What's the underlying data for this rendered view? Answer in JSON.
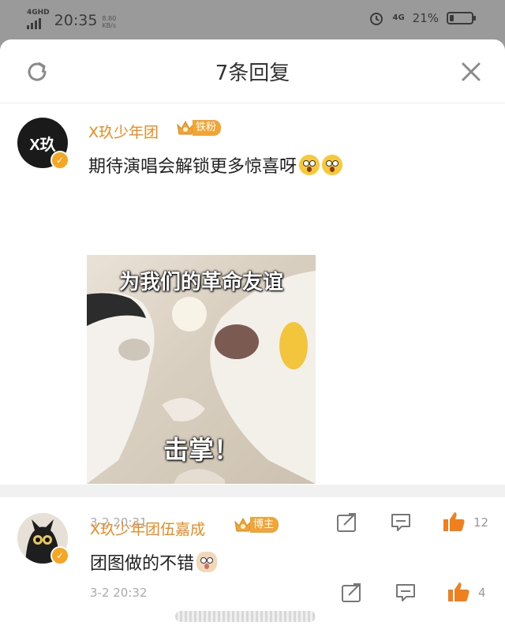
{
  "status_bar": {
    "network": "4GHD",
    "time": "20:35",
    "speed_value": "8.80",
    "speed_unit": "KB/s",
    "cell_label": "4G",
    "battery_percent": "21%",
    "battery_level": 0.21
  },
  "header": {
    "title": "7条回复",
    "refresh_icon": "refresh-icon",
    "close_icon": "close-icon"
  },
  "comments": [
    {
      "username": "X玖少年团",
      "badge": "铁粉",
      "avatar_text": "X玖",
      "text": "期待演唱会解锁更多惊喜呀",
      "emojis": [
        "scared-face-emoji",
        "scared-face-emoji"
      ],
      "image": {
        "top_caption": "为我们的革命友谊",
        "bottom_caption": "击掌！"
      },
      "timestamp": "3-2 20:31",
      "likes": "12"
    },
    {
      "username": "X玖少年团伍嘉成",
      "badge": "博主",
      "text": "团图做的不错",
      "emojis": [
        "cat-face-emoji"
      ],
      "timestamp": "3-2 20:32",
      "likes": "4"
    }
  ],
  "colors": {
    "username": "#f08a1e",
    "badge": "#f2a534",
    "like": "#f0801e"
  }
}
